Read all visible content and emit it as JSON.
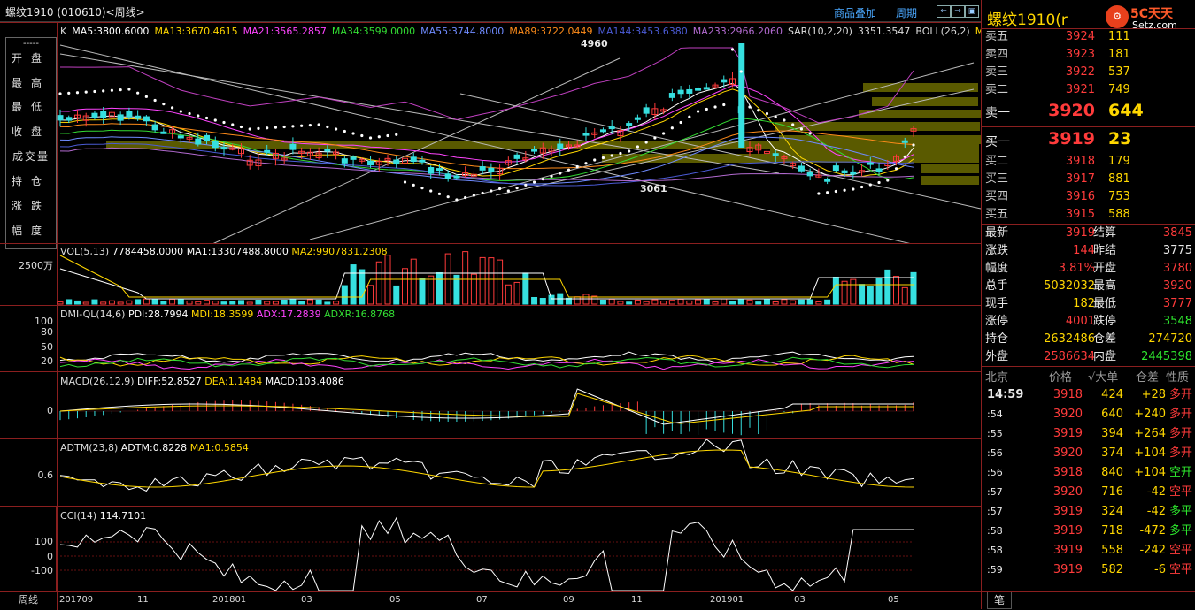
{
  "window": {
    "title": "螺纹1910 (010610)<周线>",
    "tools": [
      "商品叠加",
      "周期"
    ]
  },
  "left_panel": {
    "dash": "-----",
    "items": [
      "开盘",
      "最高",
      "最低",
      "收盘",
      "成交量",
      "持仓",
      "涨跌",
      "幅度"
    ]
  },
  "main_indicators": [
    {
      "text": "K",
      "color": "#dddddd"
    },
    {
      "text": "MA5:3800.6000",
      "color": "#ffffff"
    },
    {
      "text": "MA13:3670.4615",
      "color": "#ffd700"
    },
    {
      "text": "MA21:3565.2857",
      "color": "#ff44ff"
    },
    {
      "text": "MA34:3599.0000",
      "color": "#33dd33"
    },
    {
      "text": "MA55:3744.8000",
      "color": "#6f8bff"
    },
    {
      "text": "MA89:3722.0449",
      "color": "#ff8c1a"
    },
    {
      "text": "MA144:3453.6380",
      "color": "#4b5bd6"
    },
    {
      "text": "MA233:2966.2060",
      "color": "#b36bd1"
    },
    {
      "text": "SAR(10,2,20)",
      "color": "#dddddd"
    },
    {
      "text": "3351.3547",
      "color": "#dddddd"
    },
    {
      "text": "BOLL(26,2)",
      "color": "#dddddd"
    },
    {
      "text": "M",
      "color": "#ffd700"
    }
  ],
  "annotations": {
    "high": "4960",
    "low": "3061"
  },
  "vol": {
    "label": "VOL(5,13)",
    "vals": [
      "7784458.0000",
      "MA1:13307488.8000",
      "MA2:9907831.2308"
    ],
    "yaxis": "2500万"
  },
  "dmi": {
    "label": "DMI-QL(14,6)",
    "pdi": "PDI:28.7994",
    "mdi": "MDI:18.3599",
    "adx": "ADX:17.2839",
    "adxr": "ADXR:16.8768",
    "yaxis": [
      "100",
      "80",
      "50",
      "20"
    ]
  },
  "macd": {
    "label": "MACD(26,12,9)",
    "diff": "DIFF:52.8527",
    "dea": "DEA:1.1484",
    "macd": "MACD:103.4086",
    "yaxis": "0"
  },
  "adtm": {
    "label": "ADTM(23,8)",
    "adtm": "ADTM:0.8228",
    "ma1": "MA1:0.5854",
    "yaxis": "0.6"
  },
  "cci": {
    "label": "CCI(14)",
    "val": "114.7101",
    "yaxis": [
      "100",
      "0",
      "-100"
    ]
  },
  "xaxis": {
    "period_label": "周线",
    "ticks": [
      "201709",
      "11",
      "201801",
      "03",
      "05",
      "07",
      "09",
      "11",
      "201901",
      "03",
      "05"
    ]
  },
  "side": {
    "title": "螺纹1910(r",
    "logo_text": "5C天天",
    "logo_sub": "Setz.com",
    "asks": [
      {
        "label": "卖五",
        "price": "3924",
        "vol": "111"
      },
      {
        "label": "卖四",
        "price": "3923",
        "vol": "181"
      },
      {
        "label": "卖三",
        "price": "3922",
        "vol": "537"
      },
      {
        "label": "卖二",
        "price": "3921",
        "vol": "749"
      }
    ],
    "ask1": {
      "label": "卖一",
      "price": "3920",
      "vol": "644"
    },
    "bid1": {
      "label": "买一",
      "price": "3919",
      "vol": "23"
    },
    "bids": [
      {
        "label": "买二",
        "price": "3918",
        "vol": "179"
      },
      {
        "label": "买三",
        "price": "3917",
        "vol": "881"
      },
      {
        "label": "买四",
        "price": "3916",
        "vol": "753"
      },
      {
        "label": "买五",
        "price": "3915",
        "vol": "588"
      }
    ],
    "stats": [
      {
        "l1": "最新",
        "v1": "3919",
        "c1": "red",
        "l2": "结算",
        "v2": "3845",
        "c2": "red"
      },
      {
        "l1": "涨跌",
        "v1": "144",
        "c1": "red",
        "l2": "昨结",
        "v2": "3775",
        "c2": "wht"
      },
      {
        "l1": "幅度",
        "v1": "3.81%",
        "c1": "red",
        "l2": "开盘",
        "v2": "3780",
        "c2": "red"
      },
      {
        "l1": "总手",
        "v1": "5032032",
        "c1": "yel",
        "l2": "最高",
        "v2": "3920",
        "c2": "red"
      },
      {
        "l1": "现手",
        "v1": "182",
        "c1": "yel",
        "l2": "最低",
        "v2": "3777",
        "c2": "red"
      },
      {
        "l1": "涨停",
        "v1": "4001",
        "c1": "red",
        "l2": "跌停",
        "v2": "3548",
        "c2": "grn"
      },
      {
        "l1": "持仓",
        "v1": "2632486",
        "c1": "yel",
        "l2": "仓差",
        "v2": "274720",
        "c2": "yel"
      },
      {
        "l1": "外盘",
        "v1": "2586634",
        "c1": "red",
        "l2": "内盘",
        "v2": "2445398",
        "c2": "grn"
      }
    ],
    "ticks_header": [
      "北京",
      "价格",
      "√大单",
      "仓差",
      "性质"
    ],
    "ticks": [
      {
        "t": "14:59",
        "p": "3918",
        "v": "424",
        "d": "+28",
        "n": "多开",
        "nc": "red"
      },
      {
        "t": ":54",
        "p": "3920",
        "v": "640",
        "d": "+240",
        "n": "多开",
        "nc": "red"
      },
      {
        "t": ":55",
        "p": "3919",
        "v": "394",
        "d": "+264",
        "n": "多开",
        "nc": "red"
      },
      {
        "t": ":56",
        "p": "3920",
        "v": "374",
        "d": "+104",
        "n": "多开",
        "nc": "red"
      },
      {
        "t": ":56",
        "p": "3918",
        "v": "840",
        "d": "+104",
        "n": "空开",
        "nc": "grn"
      },
      {
        "t": ":57",
        "p": "3920",
        "v": "716",
        "d": "-42",
        "n": "空平",
        "nc": "red"
      },
      {
        "t": ":57",
        "p": "3919",
        "v": "324",
        "d": "-42",
        "n": "多平",
        "nc": "grn"
      },
      {
        "t": ":58",
        "p": "3919",
        "v": "718",
        "d": "-472",
        "n": "多平",
        "nc": "grn"
      },
      {
        "t": ":58",
        "p": "3919",
        "v": "558",
        "d": "-242",
        "n": "空平",
        "nc": "red"
      },
      {
        "t": ":59",
        "p": "3919",
        "v": "582",
        "d": "-6",
        "n": "空平",
        "nc": "red"
      }
    ],
    "bottom_tab": "笔"
  }
}
